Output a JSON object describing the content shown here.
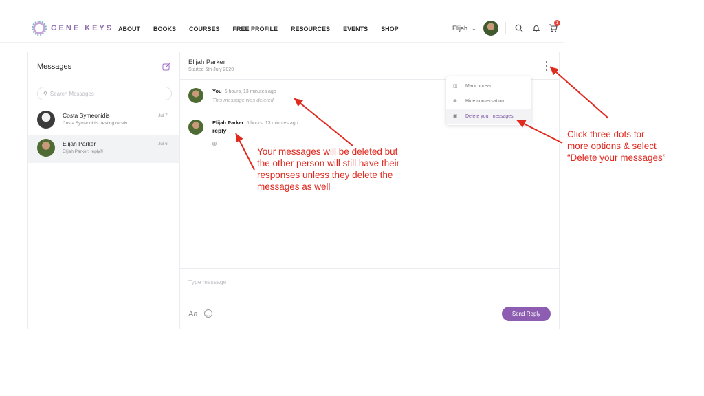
{
  "nav": {
    "brand": "GENE KEYS",
    "links": [
      "ABOUT",
      "BOOKS",
      "COURSES",
      "FREE PROFILE",
      "RESOURCES",
      "EVENTS",
      "SHOP"
    ],
    "user_name": "Elijah",
    "cart_count": "1"
  },
  "sidebar": {
    "title": "Messages",
    "search_placeholder": "Search Messages",
    "threads": [
      {
        "name": "Costa Symeonidis",
        "preview": "Costa Symeonidis: testing receiv...",
        "date": "Jul 7"
      },
      {
        "name": "Elijah Parker",
        "preview": "Elijah Parker: reply®",
        "date": "Jul 6"
      }
    ]
  },
  "conversation": {
    "name": "Elijah Parker",
    "started": "Started 6th July 2020",
    "messages": [
      {
        "author": "You",
        "time": "5 hours, 13 minutes ago",
        "text": "This message was deleted."
      },
      {
        "author": "Elijah Parker",
        "time": "5 hours, 13 minutes ago",
        "text": "reply",
        "extra": "®"
      }
    ],
    "composer_placeholder": "Type message",
    "format_label": "Aa",
    "send_label": "Send Reply"
  },
  "dropdown": {
    "items": [
      {
        "label": "Mark unread",
        "icon": "inbox-icon"
      },
      {
        "label": "Hide conversation",
        "icon": "hide-icon"
      },
      {
        "label": "Delete your messages",
        "icon": "trash-icon"
      }
    ]
  },
  "annotations": {
    "deleted_note": [
      "Your messages will be deleted but",
      "the other person will still have their",
      "responses unless they delete the",
      "messages as well"
    ],
    "options_note": [
      "Click three dots for",
      "more options & select",
      "“Delete your messages”"
    ]
  },
  "colors": {
    "accent": "#8c5db0",
    "annotation": "#e02a1f",
    "badge": "#e0453a"
  }
}
